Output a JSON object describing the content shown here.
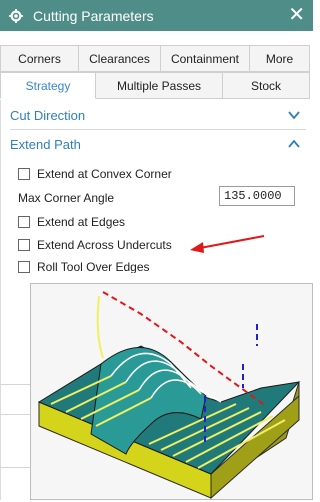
{
  "window": {
    "title": "Cutting Parameters",
    "close_glyph": "✕"
  },
  "tabs_row1": [
    "Corners",
    "Clearances",
    "Containment",
    "More"
  ],
  "tabs_row2": [
    "Strategy",
    "Multiple Passes",
    "Stock"
  ],
  "active_tab": "Strategy",
  "sections": {
    "cut_direction": {
      "label": "Cut Direction",
      "state": "collapsed"
    },
    "extend_path": {
      "label": "Extend Path",
      "state": "expanded"
    }
  },
  "options": {
    "extend_convex": {
      "label": "Extend at Convex Corner",
      "checked": false
    },
    "max_angle": {
      "label": "Max Corner Angle",
      "value": "135.0000"
    },
    "extend_edges": {
      "label": "Extend at Edges",
      "checked": false
    },
    "extend_undercuts": {
      "label": "Extend Across Undercuts",
      "checked": false
    },
    "roll_tool": {
      "label": "Roll Tool Over Edges",
      "checked": false
    }
  },
  "colors": {
    "titlebar": "#4f8e88",
    "accent_blue": "#2f7fbf",
    "arrow_red": "#e01818"
  },
  "icons": {
    "title": "gear-icon",
    "close": "close-icon",
    "cut_direction": "chevron-down-icon",
    "extend_path": "chevron-up-icon"
  }
}
